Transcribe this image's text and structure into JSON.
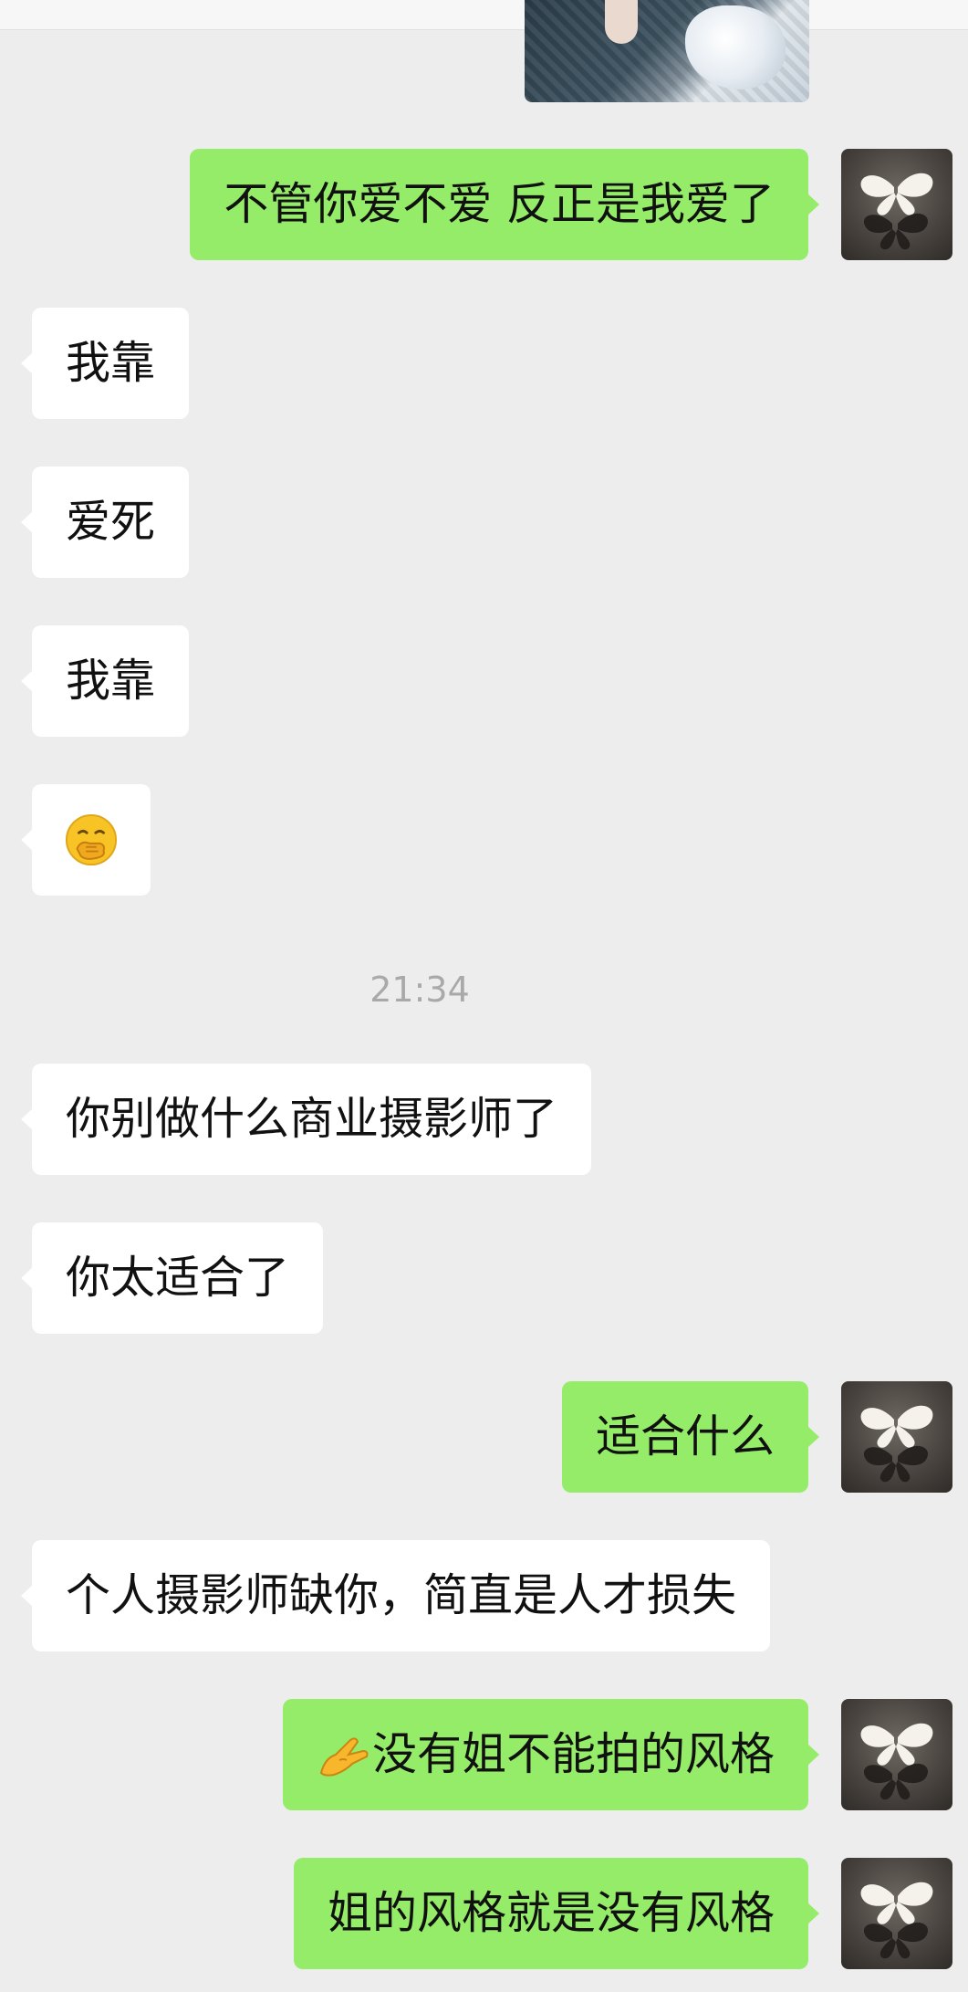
{
  "messages": [
    {
      "side": "out",
      "text": "不管你爱不爱  反正是我爱了"
    },
    {
      "side": "in",
      "text": "我靠"
    },
    {
      "side": "in",
      "text": "爱死"
    },
    {
      "side": "in",
      "text": "我靠"
    },
    {
      "side": "in",
      "emoji": "face-with-hand-over-mouth"
    },
    {
      "side": "in",
      "text": "你别做什么商业摄影师了"
    },
    {
      "side": "in",
      "text": "你太适合了"
    },
    {
      "side": "out",
      "text": "适合什么"
    },
    {
      "side": "in",
      "text": "个人摄影师缺你，简直是人才损失"
    },
    {
      "side": "out",
      "text": "没有姐不能拍的风格",
      "emoji": "pinching-hand"
    },
    {
      "side": "out",
      "text": "姐的风格就是没有风格"
    }
  ],
  "timestamp": "21:34",
  "colors": {
    "background": "#ededed",
    "incoming_bubble": "#ffffff",
    "outgoing_bubble": "#95ec69",
    "timestamp_text": "#a9a9a9"
  },
  "icons": {
    "avatar": "butterfly-avatar-icon"
  }
}
